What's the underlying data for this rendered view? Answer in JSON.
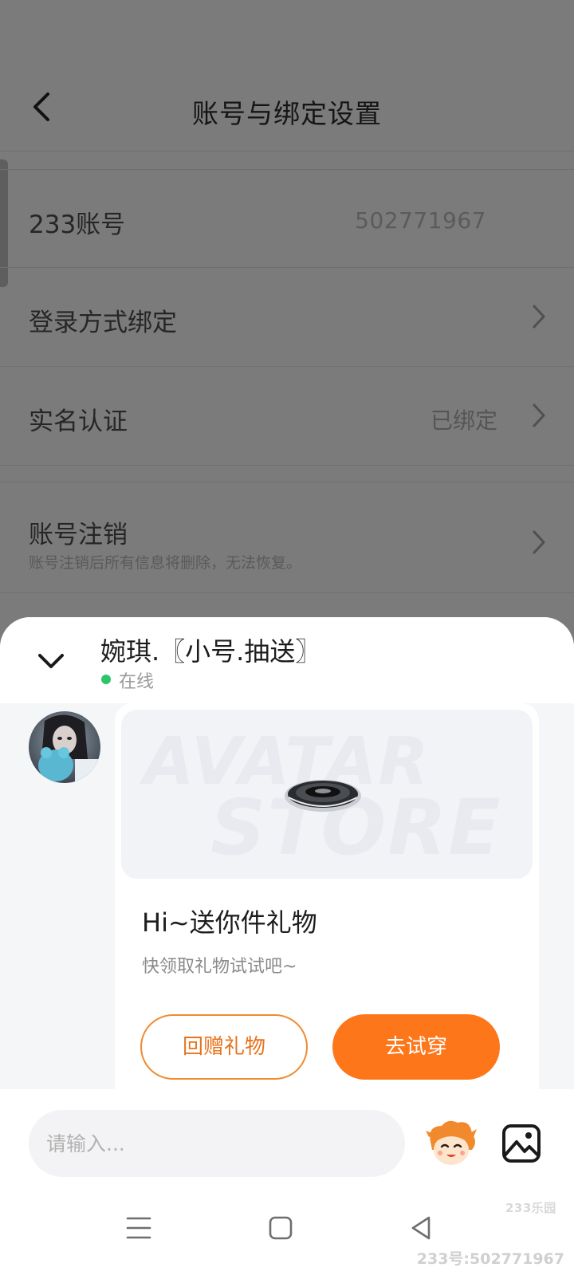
{
  "page": {
    "title": "账号与绑定设置"
  },
  "settings": {
    "rows": [
      {
        "label": "233账号",
        "value": "502771967"
      },
      {
        "label": "登录方式绑定",
        "value": ""
      },
      {
        "label": "实名认证",
        "value": "已绑定"
      },
      {
        "label": "账号注销",
        "sub": "账号注销后所有信息将删除，无法恢复。"
      }
    ]
  },
  "chat": {
    "contact_name": "婉琪.〖小号.抽送〗",
    "status": "在线",
    "status_color": "#2ec46b",
    "gift_card": {
      "banner_line1": "AVATAR",
      "banner_line2": "STORE",
      "title": "Hi~送你件礼物",
      "subtitle": "快领取礼物试试吧~",
      "return_button": "回赠礼物",
      "try_button": "去试穿",
      "accent_color": "#fd761a"
    },
    "input_placeholder": "请输入..."
  },
  "navbar": {
    "icons": [
      "menu-icon",
      "home-icon",
      "back-triangle-icon"
    ]
  },
  "watermark": {
    "logo": "233乐园",
    "id_text": "233号:502771967"
  }
}
